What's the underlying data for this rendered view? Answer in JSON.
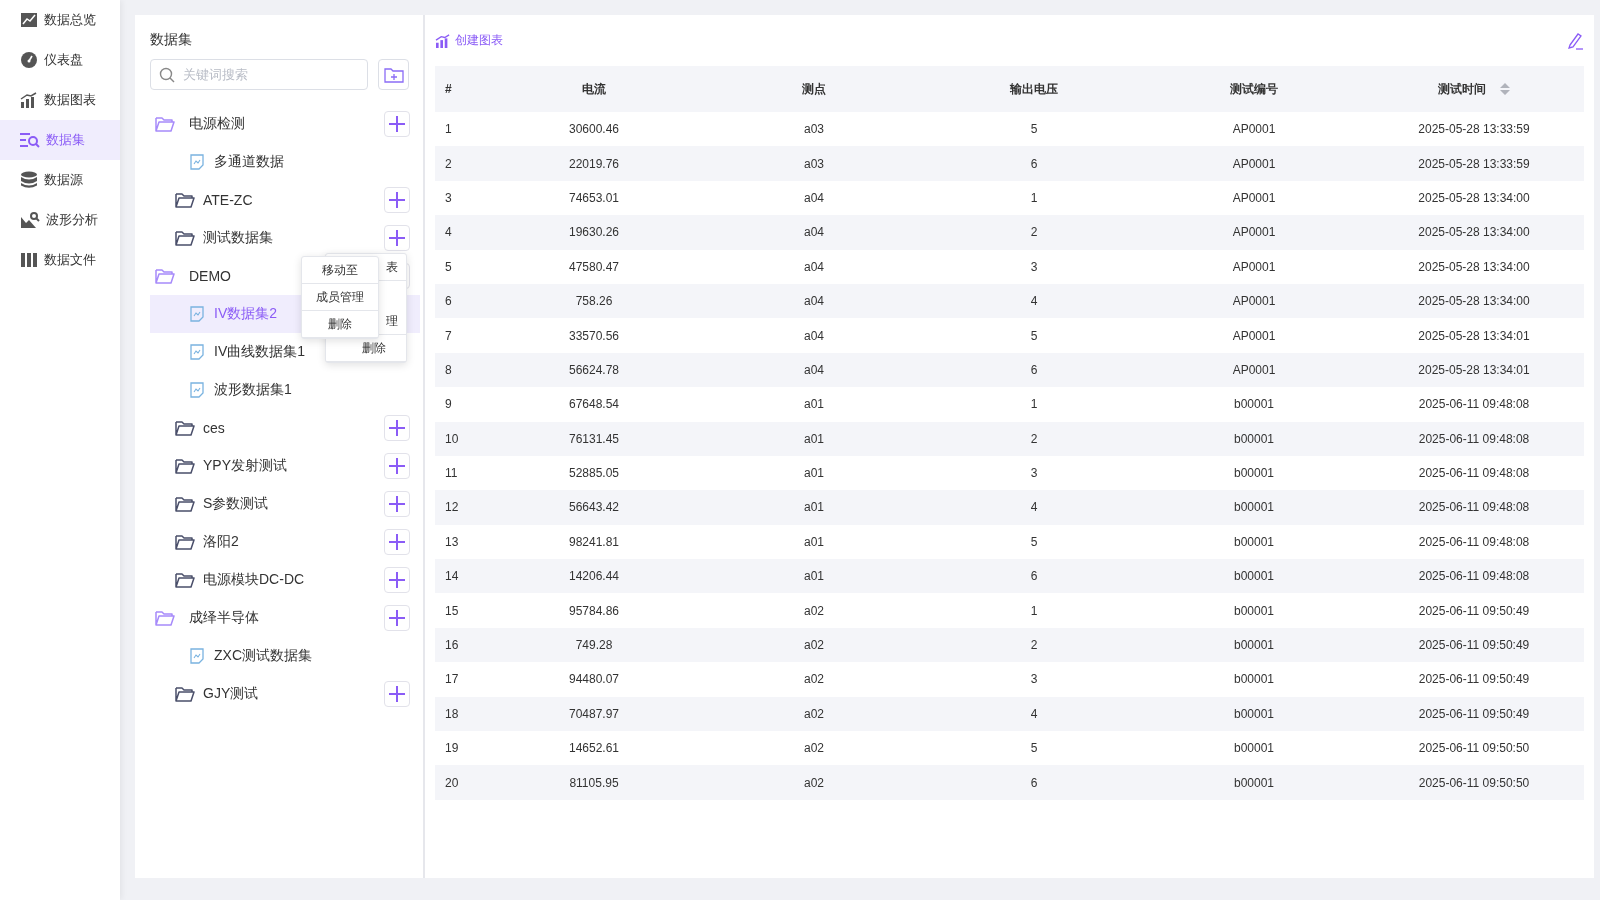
{
  "sidebar": {
    "items": [
      {
        "label": "数据总览",
        "selected": false
      },
      {
        "label": "仪表盘",
        "selected": false
      },
      {
        "label": "数据图表",
        "selected": false
      },
      {
        "label": "数据集",
        "selected": true
      },
      {
        "label": "数据源",
        "selected": false
      },
      {
        "label": "波形分析",
        "selected": false
      },
      {
        "label": "数据文件",
        "selected": false
      }
    ]
  },
  "datasets": {
    "title": "数据集",
    "search": {
      "placeholder": "关键词搜索"
    },
    "tree": [
      {
        "label": "电源检测",
        "expanded": true,
        "children": [
          {
            "label": "多通道数据",
            "selected": false
          }
        ]
      },
      {
        "label": "ATE-ZC",
        "expanded": false
      },
      {
        "label": "测试数据集",
        "expanded": false
      },
      {
        "label": "DEMO",
        "expanded": true,
        "children": [
          {
            "label": "IV数据集2",
            "selected": true
          },
          {
            "label": "IV曲线数据集1",
            "selected": false
          },
          {
            "label": "波形数据集1",
            "selected": false
          }
        ]
      },
      {
        "label": "ces",
        "expanded": false
      },
      {
        "label": "YPY发射测试",
        "expanded": false
      },
      {
        "label": "S参数测试",
        "expanded": false
      },
      {
        "label": "洛阳2",
        "expanded": false
      },
      {
        "label": "电源模块DC-DC",
        "expanded": false
      },
      {
        "label": "成绎半导体",
        "expanded": true,
        "children": [
          {
            "label": "ZXC测试数据集",
            "selected": false
          }
        ]
      },
      {
        "label": "GJY测试",
        "expanded": false
      }
    ],
    "context_menu_behind": [
      "表",
      "理",
      "删除"
    ],
    "context_menu": [
      "移动至",
      "成员管理",
      "删除"
    ]
  },
  "main": {
    "create_chart": "创建图表",
    "table": {
      "columns": [
        {
          "label": "#",
          "sortable": false
        },
        {
          "label": "电流",
          "sortable": false
        },
        {
          "label": "测点",
          "sortable": false
        },
        {
          "label": "输出电压",
          "sortable": false
        },
        {
          "label": "测试编号",
          "sortable": false
        },
        {
          "label": "测试时间",
          "sortable": true
        }
      ],
      "rows": [
        [
          "1",
          "30600.46",
          "a03",
          "5",
          "AP0001",
          "2025-05-28 13:33:59"
        ],
        [
          "2",
          "22019.76",
          "a03",
          "6",
          "AP0001",
          "2025-05-28 13:33:59"
        ],
        [
          "3",
          "74653.01",
          "a04",
          "1",
          "AP0001",
          "2025-05-28 13:34:00"
        ],
        [
          "4",
          "19630.26",
          "a04",
          "2",
          "AP0001",
          "2025-05-28 13:34:00"
        ],
        [
          "5",
          "47580.47",
          "a04",
          "3",
          "AP0001",
          "2025-05-28 13:34:00"
        ],
        [
          "6",
          "758.26",
          "a04",
          "4",
          "AP0001",
          "2025-05-28 13:34:00"
        ],
        [
          "7",
          "33570.56",
          "a04",
          "5",
          "AP0001",
          "2025-05-28 13:34:01"
        ],
        [
          "8",
          "56624.78",
          "a04",
          "6",
          "AP0001",
          "2025-05-28 13:34:01"
        ],
        [
          "9",
          "67648.54",
          "a01",
          "1",
          "b00001",
          "2025-06-11 09:48:08"
        ],
        [
          "10",
          "76131.45",
          "a01",
          "2",
          "b00001",
          "2025-06-11 09:48:08"
        ],
        [
          "11",
          "52885.05",
          "a01",
          "3",
          "b00001",
          "2025-06-11 09:48:08"
        ],
        [
          "12",
          "56643.42",
          "a01",
          "4",
          "b00001",
          "2025-06-11 09:48:08"
        ],
        [
          "13",
          "98241.81",
          "a01",
          "5",
          "b00001",
          "2025-06-11 09:48:08"
        ],
        [
          "14",
          "14206.44",
          "a01",
          "6",
          "b00001",
          "2025-06-11 09:48:08"
        ],
        [
          "15",
          "95784.86",
          "a02",
          "1",
          "b00001",
          "2025-06-11 09:50:49"
        ],
        [
          "16",
          "749.28",
          "a02",
          "2",
          "b00001",
          "2025-06-11 09:50:49"
        ],
        [
          "17",
          "94480.07",
          "a02",
          "3",
          "b00001",
          "2025-06-11 09:50:49"
        ],
        [
          "18",
          "70487.97",
          "a02",
          "4",
          "b00001",
          "2025-06-11 09:50:49"
        ],
        [
          "19",
          "14652.61",
          "a02",
          "5",
          "b00001",
          "2025-06-11 09:50:50"
        ],
        [
          "20",
          "81105.95",
          "a02",
          "6",
          "b00001",
          "2025-06-11 09:50:50"
        ]
      ]
    }
  }
}
